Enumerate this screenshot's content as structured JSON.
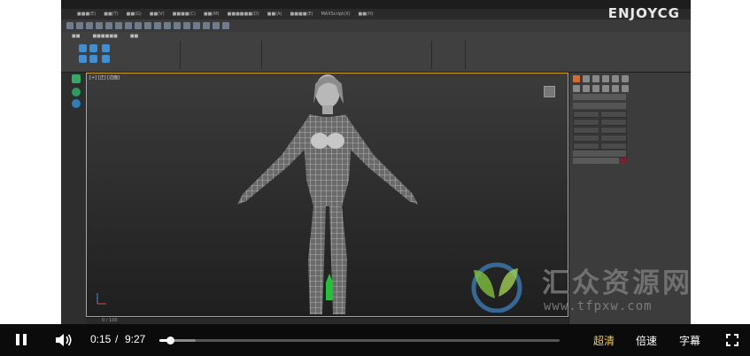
{
  "player": {
    "brand": "ENJOYCG",
    "current_time": "0:15",
    "separator": "/",
    "duration": "9:27",
    "progress_fraction": 0.0265,
    "buffered_fraction": 0.09,
    "quality_label": "超清",
    "speed_label": "倍速",
    "subtitle_label": "字幕",
    "colors": {
      "accent_quality": "#f2c94c",
      "bar": "#0b0b0b"
    }
  },
  "app": {
    "viewport_label": "[+] [正] [边面]",
    "timeline_label": "0 / 100"
  },
  "watermark": {
    "text": "汇众资源网",
    "url": "www.tfpxw.com"
  }
}
